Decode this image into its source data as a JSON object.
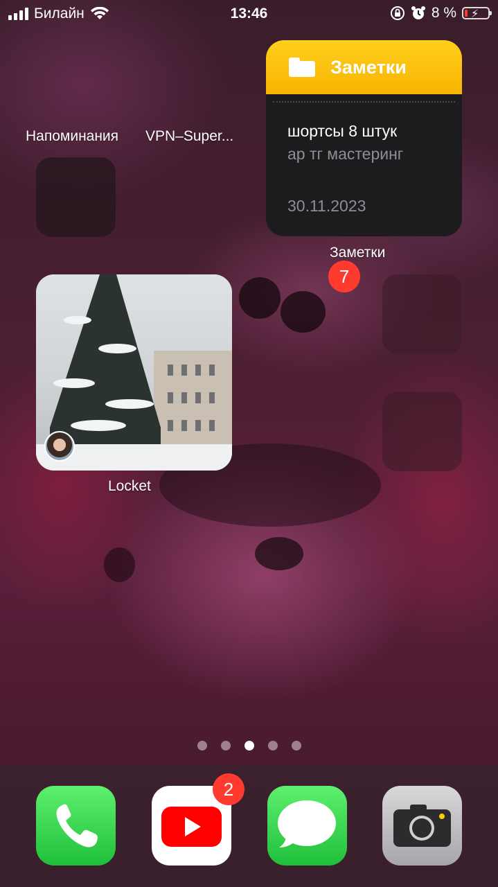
{
  "status_bar": {
    "carrier": "Билайн",
    "time": "13:46",
    "battery_percent": "8 %",
    "battery_level": 0.08
  },
  "home": {
    "folder_reminders_label": "Напоминания",
    "folder_vpn_label": "VPN–Super...",
    "notes_widget": {
      "title": "Заметки",
      "note_line1": "шортсы 8 штук",
      "note_line2": "ар тг мастеринг",
      "date": "30.11.2023",
      "label": "Заметки",
      "badge": "7"
    },
    "locket_widget": {
      "label": "Locket"
    }
  },
  "page_dots": {
    "count": 5,
    "active_index": 2
  },
  "dock": {
    "apps": [
      {
        "name": "phone-icon"
      },
      {
        "name": "youtube-icon",
        "badge": "2"
      },
      {
        "name": "messages-icon"
      },
      {
        "name": "camera-icon"
      }
    ]
  },
  "colors": {
    "notes_header": "#ffcf1d",
    "badge": "#ff3b30",
    "dock_green": "#2ad14a",
    "youtube_red": "#ff0000"
  }
}
